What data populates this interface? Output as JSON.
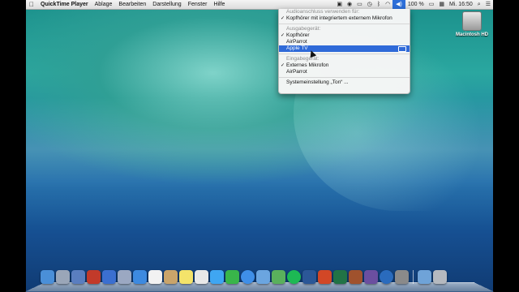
{
  "menubar": {
    "app_name": "QuickTime Player",
    "menus": [
      "Ablage",
      "Bearbeiten",
      "Darstellung",
      "Fenster",
      "Hilfe"
    ],
    "status": {
      "battery": "100 %",
      "clock": "Mi. 16:50"
    }
  },
  "audio_menu": {
    "header_output_connection": "Audioanschluss verwenden für:",
    "headphones_mic": "Kopfhörer mit integriertem externem Mikrofon",
    "header_output": "Ausgabegerät:",
    "output_devices": [
      "Kopfhörer",
      "AirParrot",
      "Apple TV"
    ],
    "header_input": "Eingabegerät:",
    "input_devices": [
      "Externes Mikrofon",
      "AirParrot"
    ],
    "system_prefs": "Systemeinstellung „Ton“ ..."
  },
  "desktop": {
    "hd_label": "Macintosh HD"
  },
  "dock": {
    "icon_names": [
      "finder-icon",
      "launchpad-icon",
      "mission-control-icon",
      "photo-booth-icon",
      "itunes-icon",
      "preview-icon",
      "app-store-icon",
      "calendar-icon",
      "contacts-icon",
      "notes-icon",
      "reminders-icon",
      "messages-icon",
      "facetime-icon",
      "safari-icon",
      "mail-icon",
      "maps-icon",
      "spotify-icon",
      "word-icon",
      "powerpoint-icon",
      "excel-icon",
      "keynote-icon",
      "imovie-icon",
      "quicktime-icon",
      "system-preferences-icon",
      "downloads-folder-icon",
      "trash-icon"
    ],
    "colors": [
      "#4a8fd8",
      "#9aa6b8",
      "#5a7ec0",
      "#c23a2a",
      "#3b6fd0",
      "#9ba8c2",
      "#3d8ae0",
      "#f2f2f2",
      "#c9a46a",
      "#f4e36a",
      "#e8e8e8",
      "#3fa6f2",
      "#39b54a",
      "#3f8fe8",
      "#6ba5e0",
      "#5ab05c",
      "#1db954",
      "#2b5797",
      "#d24726",
      "#217346",
      "#a0522d",
      "#6b4fa0",
      "#2a6bbd",
      "#8a8a8a",
      "#6fa3d8",
      "#b5b9bf"
    ]
  }
}
